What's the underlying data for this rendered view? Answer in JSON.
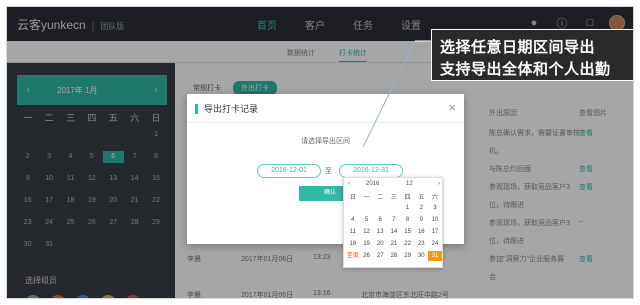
{
  "header": {
    "brand": "云客yunkecn",
    "brand_sub": "团队版",
    "nav": [
      "首页",
      "客户",
      "任务",
      "设置"
    ],
    "icons": [
      "bell-icon",
      "help-icon",
      "chat-icon",
      "avatar"
    ]
  },
  "subtabs": [
    "数据统计",
    "打卡统计"
  ],
  "calendar": {
    "header": "2017年 1月",
    "prev": "‹",
    "next": "›",
    "weekdays": [
      "一",
      "二",
      "三",
      "四",
      "五",
      "六",
      "日"
    ],
    "rows": [
      [
        "",
        "",
        "",
        "",
        "",
        "",
        "1"
      ],
      [
        "2",
        "3",
        "4",
        "5",
        "6",
        "7",
        "8"
      ],
      [
        "9",
        "10",
        "11",
        "12",
        "13",
        "14",
        "15"
      ],
      [
        "16",
        "17",
        "18",
        "19",
        "20",
        "21",
        "22"
      ],
      [
        "23",
        "24",
        "25",
        "26",
        "27",
        "28",
        "29"
      ],
      [
        "30",
        "31",
        "",
        "",
        "",
        "",
        ""
      ]
    ],
    "selected": "6",
    "members_label": "选择组员"
  },
  "list": {
    "tabs": [
      "常规打卡",
      "外出打卡"
    ],
    "right_header_1": "外出原因",
    "right_header_2": "查看图片",
    "rows": [
      {
        "reason": "陈总确认需求，需要证書审核",
        "link": "查看"
      },
      {
        "reason": "机。",
        "link": ""
      },
      {
        "reason": "与陈总约回面",
        "link": "查看"
      },
      {
        "reason": "参观现场，获取竞品客户3",
        "link": "查看"
      },
      {
        "reason": "位，待跟进",
        "link": ""
      },
      {
        "reason": "参观现场，获取竞品客户3",
        "link": "–"
      },
      {
        "reason": "位，待跟进",
        "link": ""
      },
      {
        "reason": "参加\"洞察力\"企业服务展",
        "link": "查看"
      },
      {
        "reason": "会",
        "link": ""
      }
    ],
    "bottom_rows": [
      {
        "name": "李晨",
        "date": "2017年01月06日",
        "time": "13:23"
      },
      {
        "name": "李晨",
        "date": "2017年01月06日",
        "time": "13:16",
        "addr": "北京市海淀区东北旺中路2号"
      }
    ]
  },
  "modal": {
    "title": "导出打卡记录",
    "close": "×",
    "prompt": "请选择导出区间",
    "start_date": "2016-12-01",
    "to": "至",
    "end_date": "2016-12-31",
    "confirm": "确认"
  },
  "picker": {
    "prev": "‹",
    "year": "2016",
    "month": "12",
    "next": "›",
    "weekdays": [
      "日",
      "一",
      "二",
      "三",
      "四",
      "五",
      "六"
    ],
    "rows": [
      [
        "",
        "",
        "",
        "",
        "1",
        "2",
        "3"
      ],
      [
        "4",
        "5",
        "6",
        "7",
        "8",
        "9",
        "10"
      ],
      [
        "11",
        "12",
        "13",
        "14",
        "15",
        "16",
        "17"
      ],
      [
        "18",
        "19",
        "20",
        "21",
        "22",
        "23",
        "24"
      ],
      [
        "圣诞",
        "26",
        "27",
        "28",
        "29",
        "30",
        "31"
      ]
    ],
    "selected": "31"
  },
  "annotation": {
    "line1": "选择任意日期区间导出",
    "line2": "支持导出全体和个人出勤"
  },
  "colors": {
    "accent": "#2fb9a6",
    "topbar": "#2b2f36",
    "sidebar": "#3a3f47",
    "picker_selected": "#f29a12"
  }
}
